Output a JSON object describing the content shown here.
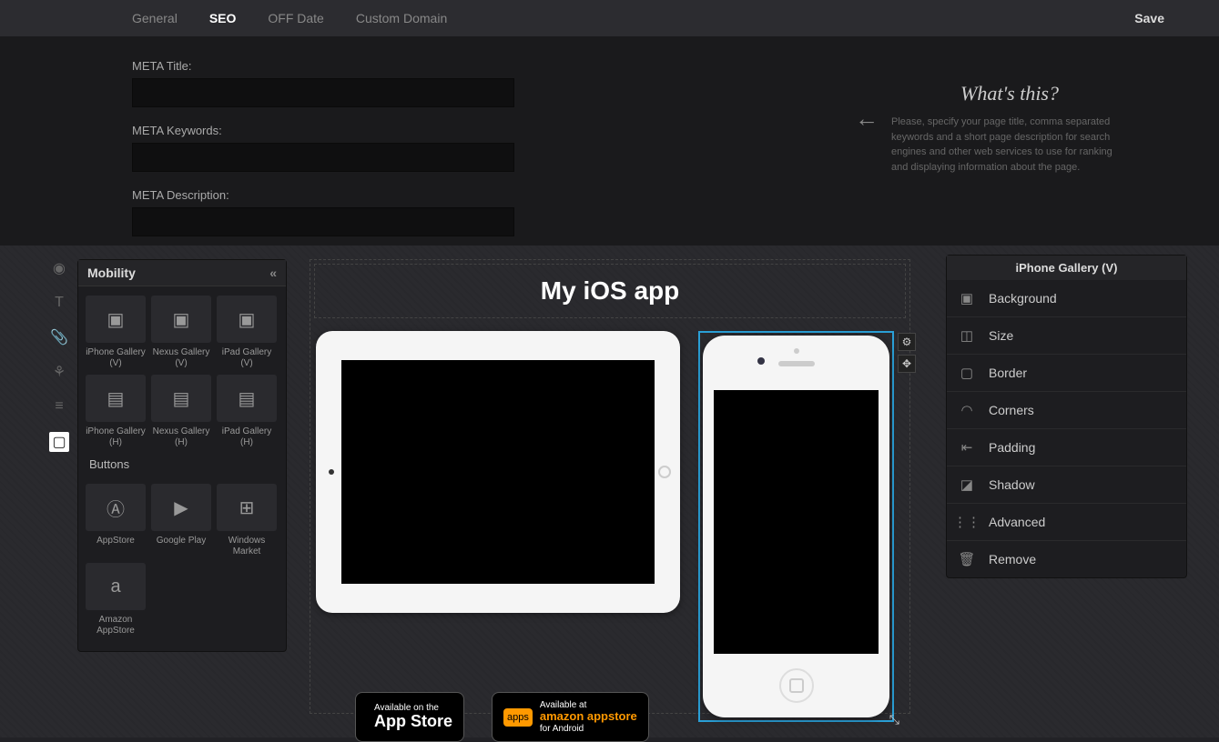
{
  "topbar": {
    "tabs": [
      "General",
      "SEO",
      "OFF Date",
      "Custom Domain"
    ],
    "active": "SEO",
    "save": "Save"
  },
  "seo": {
    "title_label": "META Title:",
    "keywords_label": "META Keywords:",
    "description_label": "META Description:"
  },
  "help": {
    "heading": "What's this?",
    "body": "Please, specify your page title, comma separated keywords and a short page description for search engines and other web services to use for ranking and displaying information about the page."
  },
  "widget_panel": {
    "title": "Mobility",
    "items_a": [
      {
        "label": "iPhone Gallery (V)"
      },
      {
        "label": "Nexus Gallery (V)"
      },
      {
        "label": "iPad Gallery (V)"
      },
      {
        "label": "iPhone Gallery (H)"
      },
      {
        "label": "Nexus Gallery (H)"
      },
      {
        "label": "iPad Gallery (H)"
      }
    ],
    "section_b": "Buttons",
    "items_b": [
      {
        "label": "AppStore"
      },
      {
        "label": "Google Play"
      },
      {
        "label": "Windows Market"
      },
      {
        "label": "Amazon AppStore"
      }
    ]
  },
  "stage": {
    "title": "My iOS app"
  },
  "badges": {
    "appstore_top": "Available on the",
    "appstore_big": "App Store",
    "amazon_top": "Available at",
    "amazon_big": "amazon appstore",
    "amazon_sub": "for Android"
  },
  "props": {
    "title": "iPhone Gallery (V)",
    "rows": [
      "Background",
      "Size",
      "Border",
      "Corners",
      "Padding",
      "Shadow",
      "Advanced",
      "Remove"
    ]
  }
}
